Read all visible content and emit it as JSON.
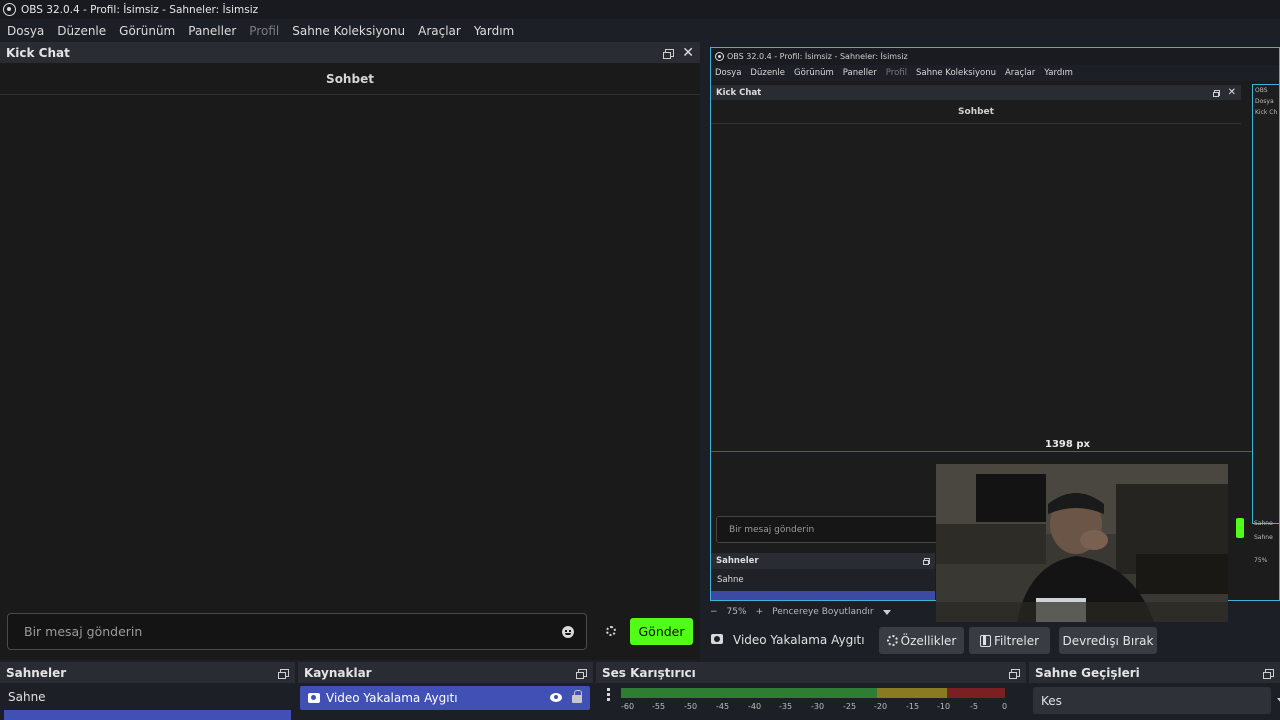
{
  "window": {
    "title": "OBS 32.0.4 - Profil: İsimsiz - Sahneler: İsimsiz"
  },
  "menu": [
    "Dosya",
    "Düzenle",
    "Görünüm",
    "Paneller",
    "Profil",
    "Sahne Koleksiyonu",
    "Araçlar",
    "Yardım"
  ],
  "kick_dock": {
    "title": "Kick Chat",
    "chat_header": "Sohbet",
    "input_placeholder": "Bir mesaj gönderin",
    "send_label": "Gönder",
    "send_color": "#53fc18"
  },
  "preview": {
    "nested_title": "OBS 32.0.4 - Profil: İsimsiz - Sahneler: İsimsiz",
    "nested_menu": [
      "Dosya",
      "Düzenle",
      "Görünüm",
      "Paneller",
      "Profil",
      "Sahne Koleksiyonu",
      "Araçlar",
      "Yardım"
    ],
    "nested_dock_title": "Kick Chat",
    "nested_chat_header": "Sohbet",
    "measure_label": "1398 px",
    "nested_input": "Bir mesaj gönderin",
    "nested_scenes_title": "Sahneler",
    "nested_scene": "Sahne",
    "nested2_lines": [
      "OBS",
      "Dosya",
      "Kick Ch"
    ],
    "nested2_bottom": [
      "Sahne",
      "Sahne",
      "75%",
      "Vid",
      "-30",
      "-45"
    ],
    "zoom_minus": "−",
    "zoom": "75%",
    "zoom_plus": "+",
    "fit": "Pencereye Boyutlandır"
  },
  "source_toolbar": {
    "source": "Video Yakalama Aygıtı",
    "properties": "Özellikler",
    "filters": "Filtreler",
    "deactivate": "Devredışı Bırak"
  },
  "scenes": {
    "title": "Sahneler",
    "items": [
      "Sahne"
    ]
  },
  "sources": {
    "title": "Kaynaklar",
    "items": [
      "Video Yakalama Aygıtı"
    ]
  },
  "mixer": {
    "title": "Ses Karıştırıcı",
    "ticks": [
      "-60",
      "-55",
      "-50",
      "-45",
      "-40",
      "-35",
      "-30",
      "-25",
      "-20",
      "-15",
      "-10",
      "-5",
      "0"
    ]
  },
  "transitions": {
    "title": "Sahne Geçişleri",
    "selected": "Kes"
  }
}
